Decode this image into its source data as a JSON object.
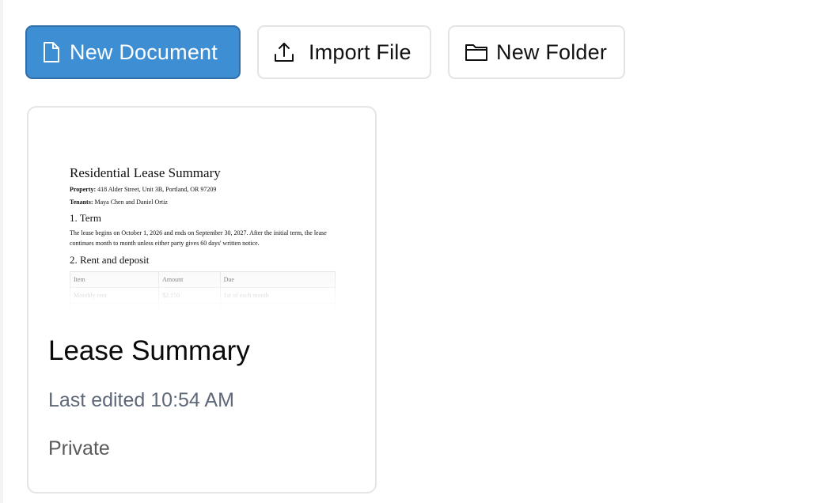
{
  "toolbar": {
    "new_document": {
      "label": "New Document",
      "icon": "file-icon"
    },
    "import_file": {
      "label": "Import File",
      "icon": "upload-icon"
    },
    "new_folder": {
      "label": "New Folder",
      "icon": "folder-icon"
    }
  },
  "colors": {
    "primary": "#3e8ed3",
    "primary_border": "#2f6ea6",
    "muted_text": "#5f6878"
  },
  "documents": [
    {
      "title": "Lease Summary",
      "last_edited": "Last edited 10:54 AM",
      "privacy": "Private",
      "preview": {
        "heading": "Residential Lease Summary",
        "property_label": "Property:",
        "property_value": "418 Alder Street, Unit 3B, Portland, OR 97209",
        "tenants_label": "Tenants:",
        "tenants_value": "Maya Chen and Daniel Ortiz",
        "section1": "1. Term",
        "section1_text": "The lease begins on October 1, 2026 and ends on September 30, 2027. After the initial term, the lease continues month to month unless either party gives 60 days' written notice.",
        "section2": "2. Rent and deposit",
        "table_headers": [
          "Item",
          "Amount",
          "Due"
        ],
        "table_rows": [
          [
            "Monthly rent",
            "$2,150",
            "1st of each month"
          ]
        ]
      }
    }
  ]
}
